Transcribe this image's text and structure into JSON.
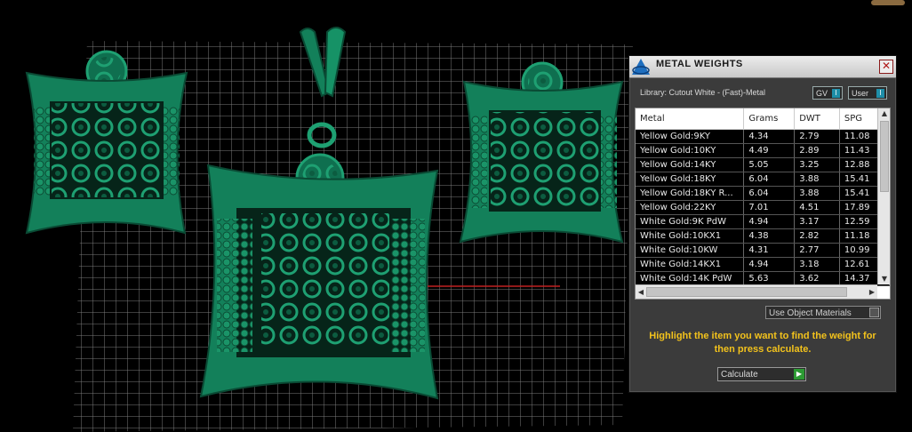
{
  "panel": {
    "title": "METAL WEIGHTS",
    "close_icon": "close-icon",
    "library": "Library: Cutout White - (Fast)-Metal",
    "gv_label": "GV",
    "user_label": "User",
    "columns": [
      "Metal",
      "Grams",
      "DWT",
      "SPG"
    ],
    "rows": [
      [
        "Yellow Gold:9KY",
        "4.34",
        "2.79",
        "11.08"
      ],
      [
        "Yellow Gold:10KY",
        "4.49",
        "2.89",
        "11.43"
      ],
      [
        "Yellow Gold:14KY",
        "5.05",
        "3.25",
        "12.88"
      ],
      [
        "Yellow Gold:18KY",
        "6.04",
        "3.88",
        "15.41"
      ],
      [
        "Yellow Gold:18KY R...",
        "6.04",
        "3.88",
        "15.41"
      ],
      [
        "Yellow Gold:22KY",
        "7.01",
        "4.51",
        "17.89"
      ],
      [
        "White Gold:9K PdW",
        "4.94",
        "3.17",
        "12.59"
      ],
      [
        "White Gold:10KX1",
        "4.38",
        "2.82",
        "11.18"
      ],
      [
        "White Gold:10KW",
        "4.31",
        "2.77",
        "10.99"
      ],
      [
        "White Gold:14KX1",
        "4.94",
        "3.18",
        "12.61"
      ],
      [
        "White Gold:14K PdW",
        "5.63",
        "3.62",
        "14.37"
      ]
    ],
    "object_materials_label": "Use Object Materials",
    "hint": "Highlight the item you want to find the weight for then press calculate.",
    "calculate_label": "Calculate"
  },
  "colors": {
    "background": "#000000",
    "grid": "#6e6e6e",
    "metal": "#15855f",
    "hint": "#f2c21c"
  }
}
